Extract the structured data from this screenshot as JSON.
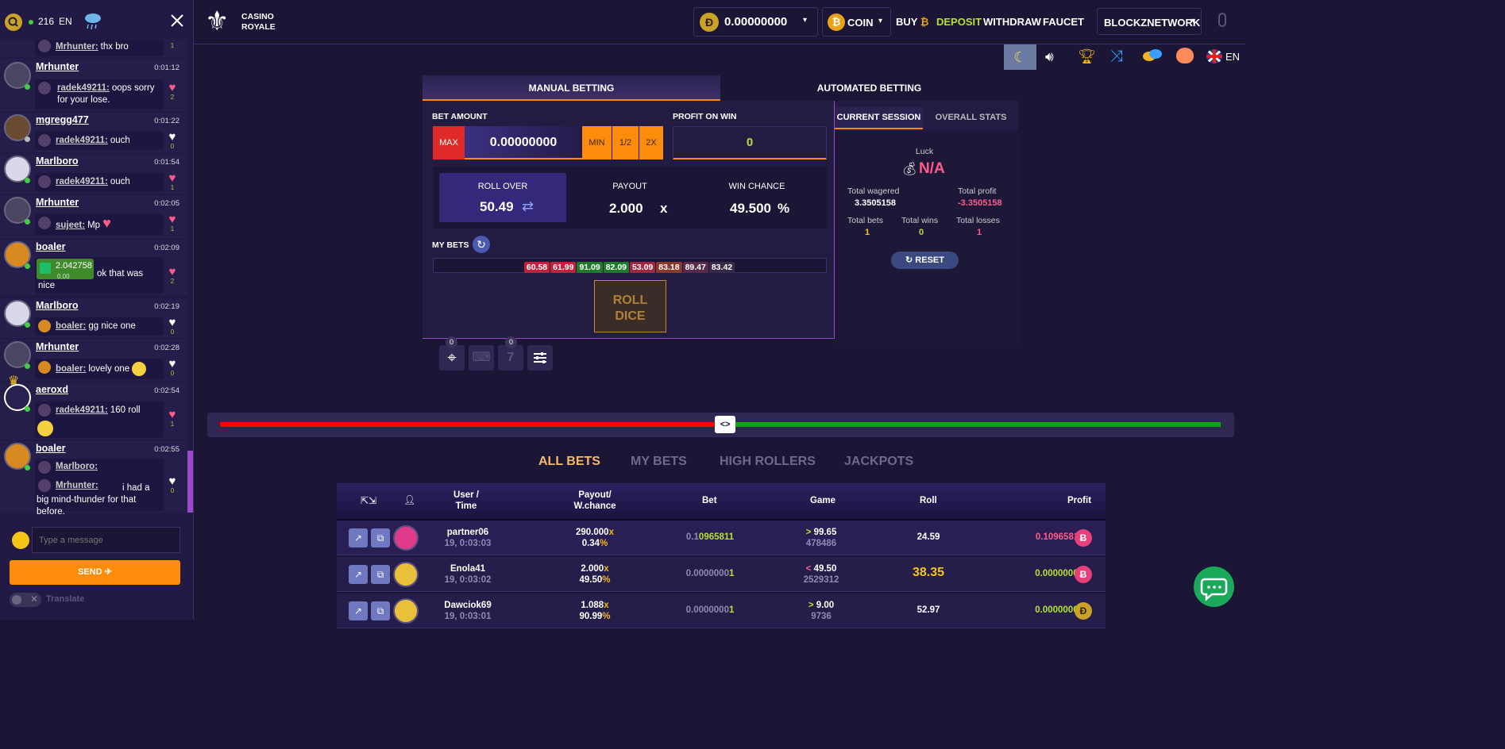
{
  "chat": {
    "online_count": "216",
    "lang": "EN",
    "input_placeholder": "Type a message",
    "send_label": "SEND",
    "translate_label": "Translate",
    "first_partial": {
      "ref": "Mrhunter:",
      "text": "thx bro",
      "likes": "1"
    },
    "messages": [
      {
        "name": "Mrhunter",
        "time": "0:01:12",
        "ref": "radek49211:",
        "text": "oops sorry for your lose.",
        "likes": "2",
        "liked": true
      },
      {
        "name": "mgregg477",
        "time": "0:01:22",
        "ref": "radek49211:",
        "text": "ouch",
        "likes": "0",
        "liked": false
      },
      {
        "name": "Marlboro",
        "time": "0:01:54",
        "ref": "radek49211:",
        "text": "ouch",
        "likes": "1",
        "liked": true
      },
      {
        "name": "Mrhunter",
        "time": "0:02:05",
        "ref": "sujeet:",
        "text": "Mp",
        "likes": "1",
        "liked": true
      },
      {
        "name": "boaler",
        "time": "0:02:09",
        "tip_amount": "2.042758",
        "tip_usd": "0.00",
        "text": "ok that was nice",
        "likes": "2",
        "liked": true
      },
      {
        "name": "Marlboro",
        "time": "0:02:19",
        "ref": "boaler:",
        "text": "gg nice one",
        "likes": "0",
        "liked": false
      },
      {
        "name": "Mrhunter",
        "time": "0:02:28",
        "ref": "boaler:",
        "text": "lovely one",
        "likes": "0",
        "liked": false
      },
      {
        "name": "aeroxd",
        "time": "0:02:54",
        "ref": "radek49211:",
        "text": "160 roll",
        "likes": "1",
        "liked": true
      },
      {
        "name": "boaler",
        "time": "0:02:55",
        "ref": "Marlboro:",
        "ref2": "Mrhunter:",
        "text": "i had a big mind-thunder for that before.",
        "likes": "0",
        "liked": false
      }
    ]
  },
  "header": {
    "logo_line1": "CASINO",
    "logo_line2": "ROYALE",
    "balance": "0.00000000",
    "currency": "COIN",
    "buy_label": "BUY",
    "deposit_label": "DEPOSIT",
    "withdraw_label": "WITHDRAW",
    "faucet_label": "FAUCET",
    "network_label": "BLOCKZNETWORK",
    "lang": "EN"
  },
  "betting": {
    "tab_manual": "MANUAL BETTING",
    "tab_auto": "AUTOMATED BETTING",
    "bet_amount_label": "BET AMOUNT",
    "max_label": "MAX",
    "bet_amount": "0.00000000",
    "min_label": "MIN",
    "half_label": "1/2",
    "double_label": "2X",
    "profit_label": "PROFIT ON WIN",
    "profit_value": "0",
    "roll_over_label": "ROLL OVER",
    "roll_over_value": "50.49",
    "payout_label": "PAYOUT",
    "payout_value": "2.000",
    "payout_unit": "x",
    "win_chance_label": "WIN CHANCE",
    "win_chance_value": "49.500",
    "win_chance_unit": "%",
    "my_bets_label": "MY BETS",
    "recent_bets": [
      {
        "v": "60.58",
        "c": "#c0213c"
      },
      {
        "v": "61.99",
        "c": "#c0213c"
      },
      {
        "v": "91.09",
        "c": "#1f7a2a"
      },
      {
        "v": "82.09",
        "c": "#1f7a2a"
      },
      {
        "v": "53.09",
        "c": "#a32640"
      },
      {
        "v": "83.18",
        "c": "#8a3a2a"
      },
      {
        "v": "89.47",
        "c": "#5a2a4a"
      },
      {
        "v": "83.42",
        "c": "#3a2a4a"
      }
    ],
    "roll_line1": "ROLL",
    "roll_line2": "DICE",
    "tool_badge_1": "0",
    "tool_badge_2": "0",
    "slider_value": "50.49"
  },
  "stats": {
    "tab_current": "CURRENT SESSION",
    "tab_overall": "OVERALL STATS",
    "luck_label": "Luck",
    "luck_value": "N/A",
    "wagered_label": "Total wagered",
    "wagered_value": "3.3505158",
    "profit_label": "Total profit",
    "profit_value": "-3.3505158",
    "bets_label": "Total bets",
    "bets_value": "1",
    "wins_label": "Total wins",
    "wins_value": "0",
    "losses_label": "Total losses",
    "losses_value": "1",
    "reset_label": "RESET"
  },
  "bets_table": {
    "tabs": [
      "ALL BETS",
      "MY BETS",
      "HIGH ROLLERS",
      "JACKPOTS"
    ],
    "headers": {
      "user1": "User /",
      "user2": "Time",
      "payout1": "Payout/",
      "payout2": "W.chance",
      "bet": "Bet",
      "game": "Game",
      "roll": "Roll",
      "profit": "Profit"
    },
    "rows": [
      {
        "user": "partner06",
        "time": "19, 0:03:03",
        "payout": "290.000",
        "chance": "0.34",
        "bet_a": "0.1",
        "bet_b": "0965811",
        "cmp": ">",
        "target": "99.65",
        "game_id": "478486",
        "roll": "24.59",
        "profit": "0.10965811",
        "profit_color": "#ff5c8a"
      },
      {
        "user": "Enola41",
        "time": "19, 0:03:02",
        "payout": "2.000",
        "chance": "49.50",
        "bet_a": "0.0000000",
        "bet_b": "1",
        "cmp": "<",
        "target": "49.50",
        "game_id": "2529312",
        "roll": "38.35",
        "profit": "0.00000001",
        "profit_color": "#b8e030"
      },
      {
        "user": "Dawciok69",
        "time": "19, 0:03:01",
        "payout": "1.088",
        "chance": "90.99",
        "bet_a": "0.0000000",
        "bet_b": "1",
        "cmp": ">",
        "target": "9.00",
        "game_id": "9736",
        "roll": "52.97",
        "profit": "0.00000000",
        "profit_color": "#b8e030"
      }
    ]
  }
}
